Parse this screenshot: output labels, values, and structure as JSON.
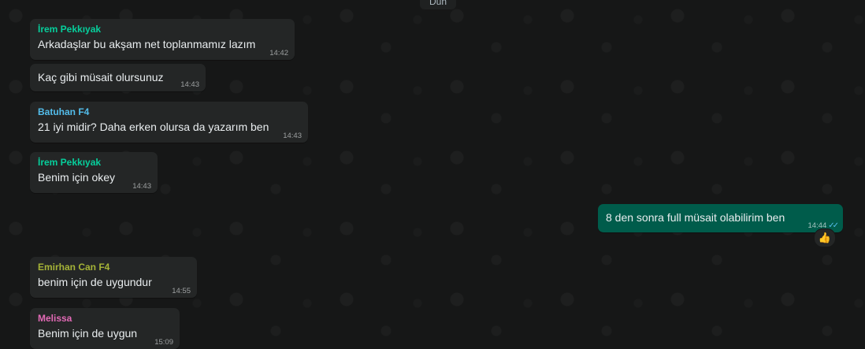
{
  "date_chip": "Dün",
  "messages": [
    {
      "sender": "İrem Pekkıyak",
      "sender_color": "#06cf9c",
      "text": "Arkadaşlar bu akşam net toplanmamız lazım",
      "time": "14:42"
    },
    {
      "sender": "",
      "text": "Kaç gibi müsait olursunuz",
      "time": "14:43"
    },
    {
      "sender": "Batuhan F4",
      "sender_color": "#53bdeb",
      "text": "21 iyi midir? Daha erken olursa da yazarım ben",
      "time": "14:43"
    },
    {
      "sender": "İrem Pekkıyak",
      "sender_color": "#06cf9c",
      "text": "Benim için okey",
      "time": "14:43"
    },
    {
      "outgoing": true,
      "text": "8 den sonra full müsait olabilirim ben",
      "time": "14:44",
      "status": "read",
      "reaction": "👍"
    },
    {
      "sender": "Emirhan Can F4",
      "sender_color": "#a5b337",
      "text": "benim için de uygundur",
      "time": "14:55"
    },
    {
      "sender": "Melissa",
      "sender_color": "#e26ab6",
      "text": "Benim için de uygun",
      "time": "15:09"
    }
  ]
}
